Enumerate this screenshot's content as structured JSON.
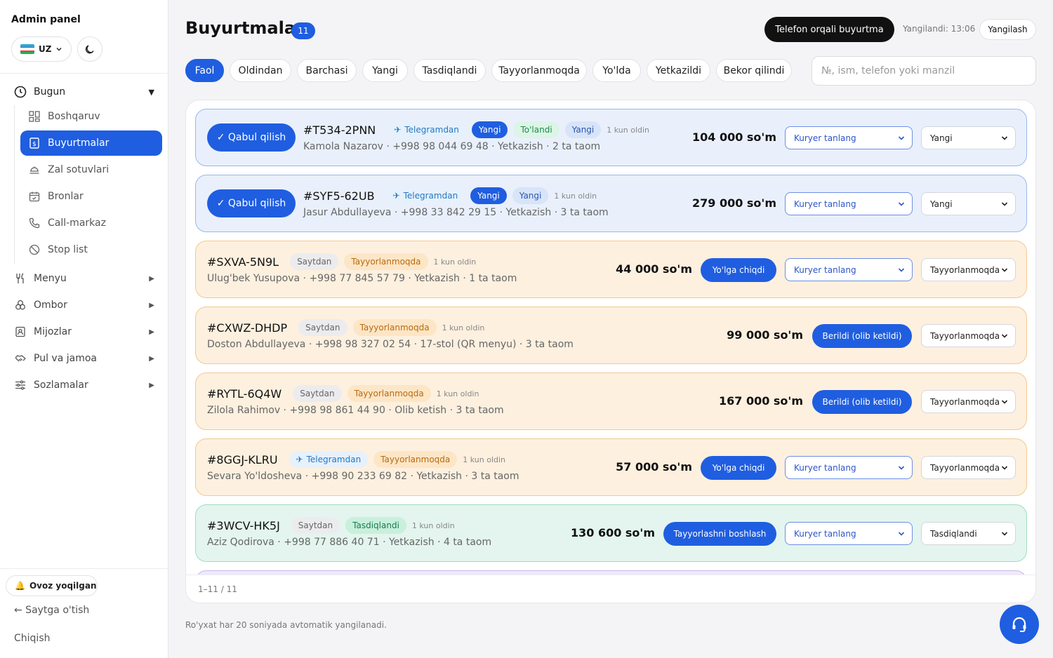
{
  "sidebar": {
    "brand": "Admin panel",
    "lang": "UZ",
    "section": {
      "label": "Bugun",
      "expanded_icon": "triangle-down"
    },
    "sub_items": [
      {
        "label": "Boshqaruv",
        "icon": "grid-icon"
      },
      {
        "label": "Buyurtmalar",
        "icon": "orders-icon",
        "active": true
      },
      {
        "label": "Zal sotuvlari",
        "icon": "dish-icon"
      },
      {
        "label": "Bronlar",
        "icon": "calendar-icon"
      },
      {
        "label": "Call-markaz",
        "icon": "phone-icon"
      },
      {
        "label": "Stop list",
        "icon": "ban-icon"
      }
    ],
    "groups": [
      {
        "label": "Menyu",
        "icon": "cutlery-icon"
      },
      {
        "label": "Ombor",
        "icon": "boxes-icon"
      },
      {
        "label": "Mijozlar",
        "icon": "contact-icon"
      },
      {
        "label": "Pul va jamoa",
        "icon": "handshake-icon"
      },
      {
        "label": "Sozlamalar",
        "icon": "sliders-icon"
      }
    ],
    "sound": "Ovoz yoqilgan",
    "back": "← Saytga o'tish",
    "logout": "Chiqish"
  },
  "header": {
    "title": "Buyurtmalar",
    "count": "11",
    "phone_order": "Telefon orqali buyurtma",
    "updated": "Yangilandi: 13:06",
    "refresh": "Yangilash"
  },
  "tabs": [
    "Faol",
    "Oldindan",
    "Barchasi",
    "Yangi",
    "Tasdiqlandi",
    "Tayyorlanmoqda",
    "Yo'lda",
    "Yetkazildi",
    "Bekor qilindi"
  ],
  "search": {
    "placeholder": "№, ism, telefon yoki manzil"
  },
  "accept_label": "✓ Qabul qilish",
  "courier_placeholder": "Kuryer tanlang",
  "orders": [
    {
      "no": "#T534-2PNN",
      "source": "Telegramdan",
      "status_badge": "Yangi",
      "paid": "To'landi",
      "flag": "Yangi",
      "ago": "1 kun oldin",
      "info": "Kamola Nazarov · +998 98 044 69 48 · Yetkazish · 2 ta taom",
      "price": "104 000 so'm",
      "status": "Yangi"
    },
    {
      "no": "#SYF5-62UB",
      "source": "Telegramdan",
      "status_badge": "Yangi",
      "flag": "Yangi",
      "ago": "1 kun oldin",
      "info": "Jasur Abdullayeva · +998 33 842 29 15 · Yetkazish · 3 ta taom",
      "price": "279 000 so'm",
      "status": "Yangi"
    },
    {
      "no": "#SXVA-5N9L",
      "source": "Saytdan",
      "status_badge": "Tayyorlanmoqda",
      "ago": "1 kun oldin",
      "info": "Ulug'bek Yusupova · +998 77 845 57 79 · Yetkazish · 1 ta taom",
      "price": "44 000 so'm",
      "action": "Yo'lga chiqdi",
      "status": "Tayyorlanmoqda"
    },
    {
      "no": "#CXWZ-DHDP",
      "source": "Saytdan",
      "status_badge": "Tayyorlanmoqda",
      "ago": "1 kun oldin",
      "info": "Doston Abdullayeva · +998 98 327 02 54 · 17-stol (QR menyu) · 3 ta taom",
      "price": "99 000 so'm",
      "action": "Berildi (olib ketildi)",
      "status": "Tayyorlanmoqda"
    },
    {
      "no": "#RYTL-6Q4W",
      "source": "Saytdan",
      "status_badge": "Tayyorlanmoqda",
      "ago": "1 kun oldin",
      "info": "Zilola Rahimov · +998 98 861 44 90 · Olib ketish · 3 ta taom",
      "price": "167 000 so'm",
      "action": "Berildi (olib ketildi)",
      "status": "Tayyorlanmoqda"
    },
    {
      "no": "#8GGJ-KLRU",
      "source": "Telegramdan",
      "status_badge": "Tayyorlanmoqda",
      "ago": "1 kun oldin",
      "info": "Sevara Yo'ldosheva · +998 90 233 69 82 · Yetkazish · 3 ta taom",
      "price": "57 000 so'm",
      "action": "Yo'lga chiqdi",
      "status": "Tayyorlanmoqda"
    },
    {
      "no": "#3WCV-HK5J",
      "source": "Saytdan",
      "status_badge": "Tasdiqlandi",
      "ago": "1 kun oldin",
      "info": "Aziz Qodirova · +998 77 886 40 71 · Yetkazish · 4 ta taom",
      "price": "130 600 so'm",
      "action": "Tayyorlashni boshlash",
      "status": "Tasdiqlandi"
    }
  ],
  "pager": "1–11 / 11",
  "auto_note": "Ro'yxat har 20 soniyada avtomatik yangilanadi.",
  "colors": {
    "accent": "#1f5ee0",
    "new_card": "#e9f0fc",
    "prep_card": "#fdf0df",
    "confirmed_card": "#e3f5ee"
  }
}
